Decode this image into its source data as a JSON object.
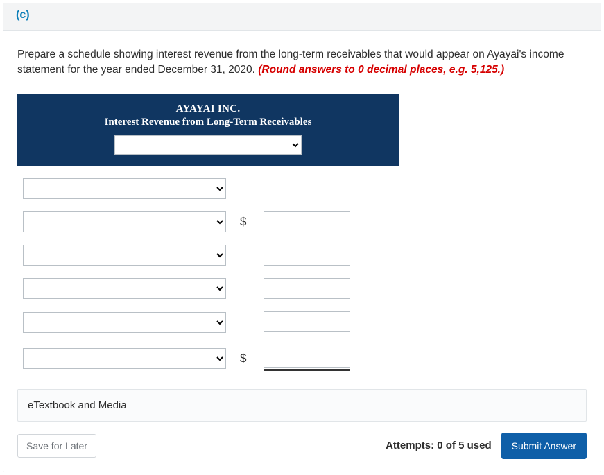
{
  "header": {
    "part": "(c)"
  },
  "question": {
    "text": "Prepare a schedule showing interest revenue from the long-term receivables that would appear on Ayayai's income statement for the year ended December 31, 2020. ",
    "hint": "(Round answers to 0 decimal places, e.g. 5,125.)"
  },
  "schedule_header": {
    "company": "AYAYAI INC.",
    "title": "Interest Revenue from Long-Term Receivables"
  },
  "rows": [
    {
      "has_value": false,
      "dollar": ""
    },
    {
      "has_value": true,
      "dollar": "$"
    },
    {
      "has_value": true,
      "dollar": ""
    },
    {
      "has_value": true,
      "dollar": ""
    },
    {
      "has_value": true,
      "dollar": "",
      "underline": "single"
    },
    {
      "has_value": true,
      "dollar": "$",
      "underline": "double"
    }
  ],
  "resources": {
    "label": "eTextbook and Media"
  },
  "footer": {
    "save": "Save for Later",
    "attempts": "Attempts: 0 of 5 used",
    "submit": "Submit Answer"
  }
}
